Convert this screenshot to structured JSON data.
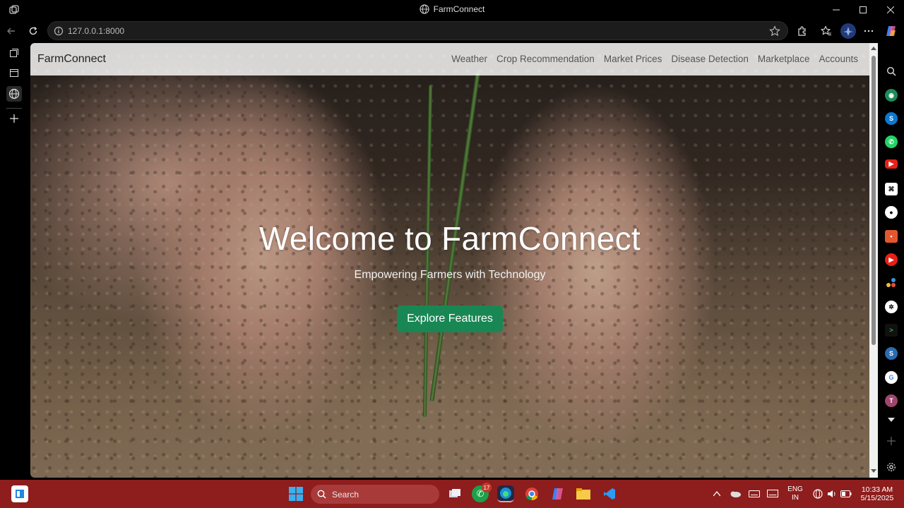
{
  "window": {
    "title": "FarmConnect"
  },
  "address_bar": {
    "url": "127.0.0.1:8000"
  },
  "site": {
    "brand": "FarmConnect",
    "nav": [
      "Weather",
      "Crop Recommendation",
      "Market Prices",
      "Disease Detection",
      "Marketplace",
      "Accounts"
    ],
    "hero": {
      "title": "Welcome to FarmConnect",
      "subtitle": "Empowering Farmers with Technology",
      "cta": "Explore Features"
    },
    "colors": {
      "cta": "#198754",
      "navbar": "rgba(255,255,255,0.82)"
    }
  },
  "sidebar_right": [
    "search-icon",
    "copilot-icon",
    "skype-icon",
    "whatsapp-icon",
    "youtube-icon",
    "app-icon",
    "github-icon",
    "office-icon",
    "youtube-music-icon",
    "apps-icon",
    "chatgpt-icon",
    "terminal-icon",
    "s-icon",
    "google-icon",
    "t-avatar-icon",
    "chevron-down-icon",
    "plus-icon",
    "settings-icon"
  ],
  "taskbar": {
    "search_label": "Search",
    "whatsapp_badge": "17",
    "lang_top": "ENG",
    "lang_bottom": "IN",
    "time": "10:33 AM",
    "date": "5/15/2025",
    "color": "#8e1d1d"
  }
}
